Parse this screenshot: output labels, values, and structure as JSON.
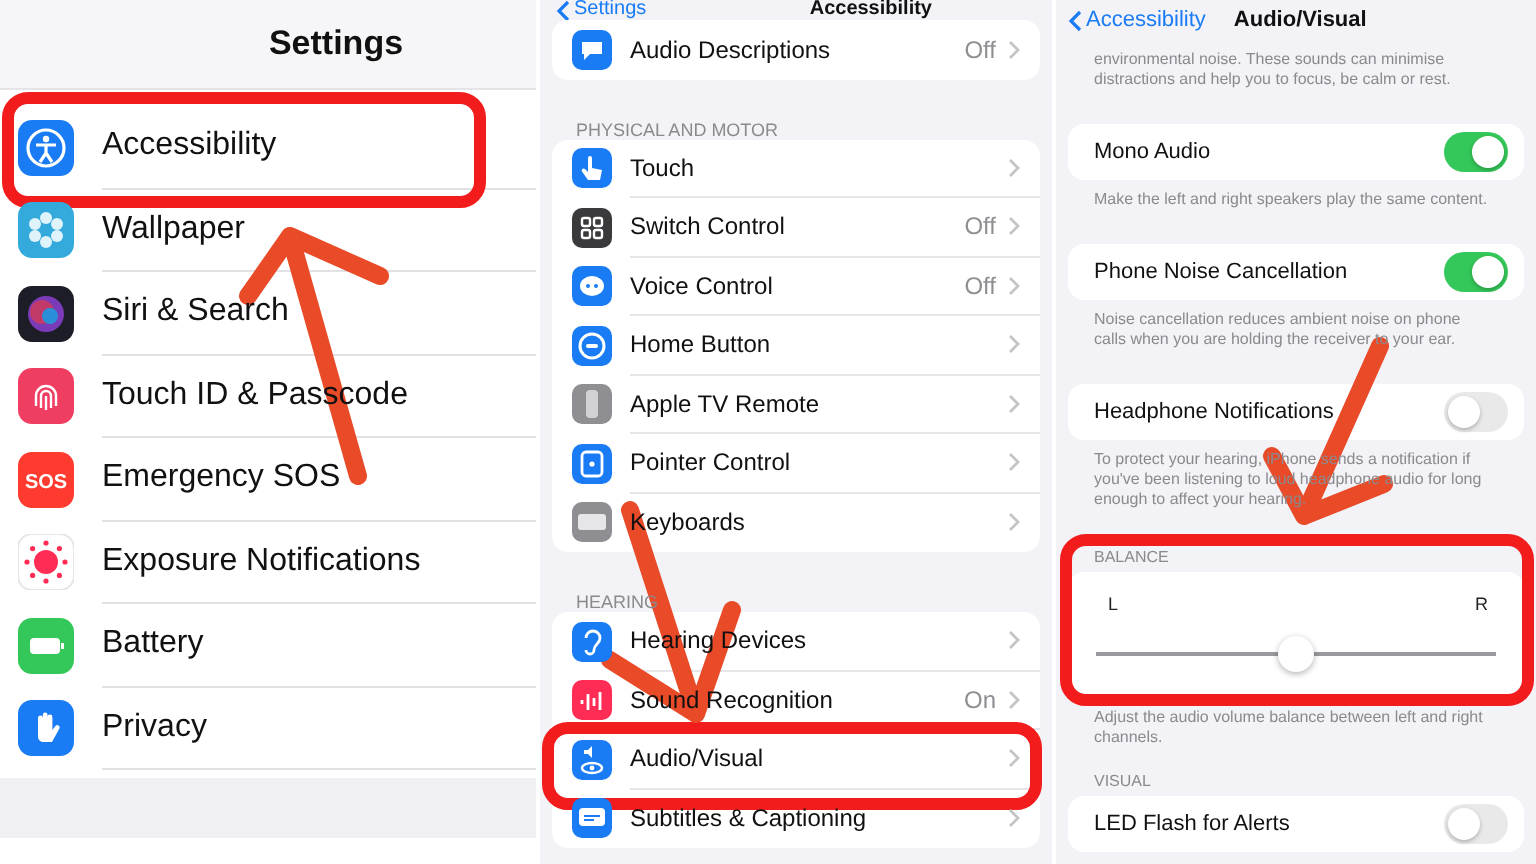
{
  "settings_screen": {
    "title": "Settings",
    "rows": [
      {
        "label": "Accessibility"
      },
      {
        "label": "Wallpaper"
      },
      {
        "label": "Siri & Search"
      },
      {
        "label": "Touch ID & Passcode"
      },
      {
        "label": "Emergency SOS",
        "icon_label": "SOS"
      },
      {
        "label": "Exposure Notifications"
      },
      {
        "label": "Battery"
      },
      {
        "label": "Privacy"
      }
    ]
  },
  "accessibility_screen": {
    "back": "Settings",
    "title": "Accessibility",
    "groups": [
      {
        "rows": [
          {
            "label": "Audio Descriptions",
            "value": "Off"
          }
        ]
      },
      {
        "header": "PHYSICAL AND MOTOR",
        "rows": [
          {
            "label": "Touch"
          },
          {
            "label": "Switch Control",
            "value": "Off"
          },
          {
            "label": "Voice Control",
            "value": "Off"
          },
          {
            "label": "Home Button"
          },
          {
            "label": "Apple TV Remote"
          },
          {
            "label": "Pointer Control"
          },
          {
            "label": "Keyboards"
          }
        ]
      },
      {
        "header": "HEARING",
        "rows": [
          {
            "label": "Hearing Devices"
          },
          {
            "label": "Sound Recognition",
            "value": "On"
          },
          {
            "label": "Audio/Visual"
          },
          {
            "label": "Subtitles & Captioning"
          }
        ]
      }
    ]
  },
  "audio_visual_screen": {
    "back": "Accessibility",
    "title": "Audio/Visual",
    "items": [
      {
        "kind": "note",
        "text": "environmental noise. These sounds can minimise distractions and help you to focus, be calm or rest."
      },
      {
        "kind": "toggle",
        "label": "Mono Audio",
        "on": true
      },
      {
        "kind": "note",
        "text": "Make the left and right speakers play the same content."
      },
      {
        "kind": "toggle",
        "label": "Phone Noise Cancellation",
        "on": true
      },
      {
        "kind": "note",
        "text": "Noise cancellation reduces ambient noise on phone calls when you are holding the receiver to your ear."
      },
      {
        "kind": "toggle",
        "label": "Headphone Notifications",
        "on": false
      },
      {
        "kind": "note",
        "text": "To protect your hearing, iPhone sends a notification if you've been listening to loud headphone audio for long enough to affect your hearing."
      },
      {
        "kind": "header",
        "text": "BALANCE"
      },
      {
        "kind": "slider",
        "left": "L",
        "right": "R",
        "level": 0.5
      },
      {
        "kind": "note",
        "text": "Adjust the audio volume balance between left and right channels."
      },
      {
        "kind": "header",
        "text": "VISUAL"
      },
      {
        "kind": "toggle",
        "label": "LED Flash for Alerts",
        "on": false
      }
    ]
  }
}
